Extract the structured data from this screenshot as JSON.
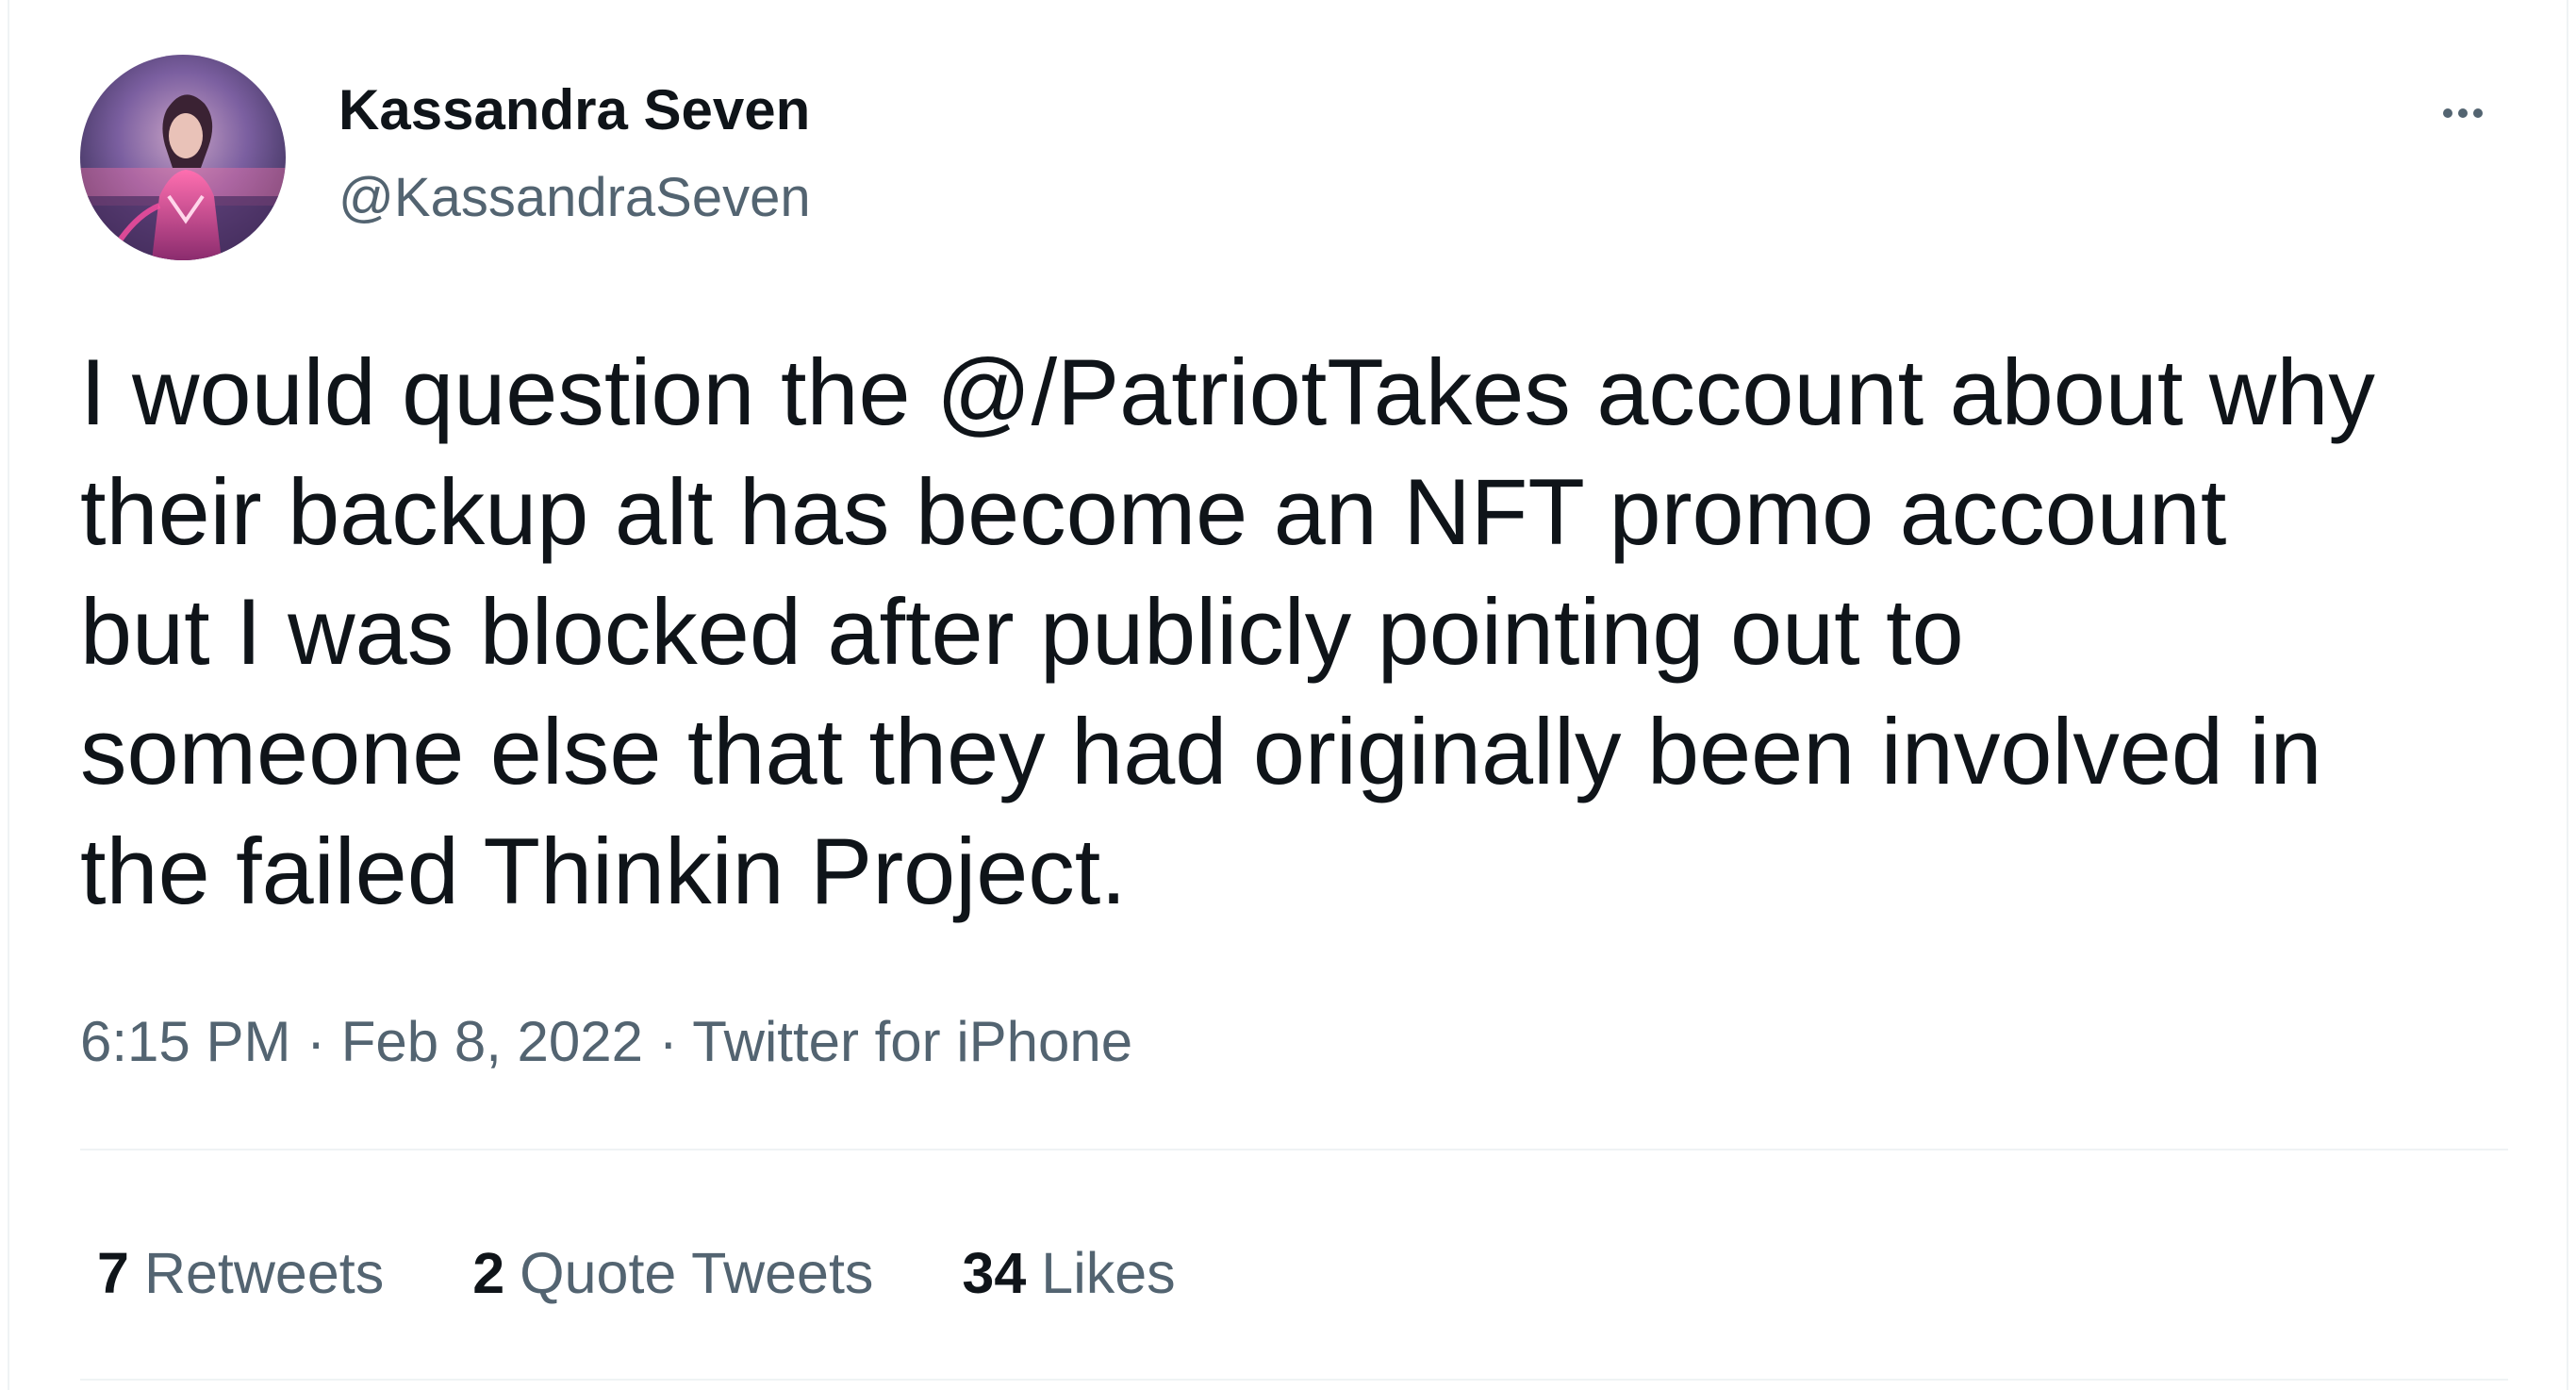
{
  "author": {
    "display_name": "Kassandra Seven",
    "handle": "@KassandraSeven",
    "avatar_icon": "profile-avatar"
  },
  "more_icon": "ellipsis-icon",
  "tweet": {
    "text": "I would question the @/PatriotTakes account about why\ntheir backup alt has become an NFT promo account\nbut I was blocked after publicly pointing out to\nsomeone else that they had originally been involved in\nthe failed Thinkin Project."
  },
  "meta": {
    "time": "6:15 PM",
    "separator": "·",
    "date": "Feb 8, 2022",
    "source": "Twitter for iPhone"
  },
  "stats": {
    "retweets": {
      "count": "7",
      "label": "Retweets"
    },
    "quote_tweets": {
      "count": "2",
      "label": "Quote Tweets"
    },
    "likes": {
      "count": "34",
      "label": "Likes"
    }
  },
  "colors": {
    "text_primary": "#0f1419",
    "text_secondary": "#536471",
    "divider": "#eff3f4"
  }
}
